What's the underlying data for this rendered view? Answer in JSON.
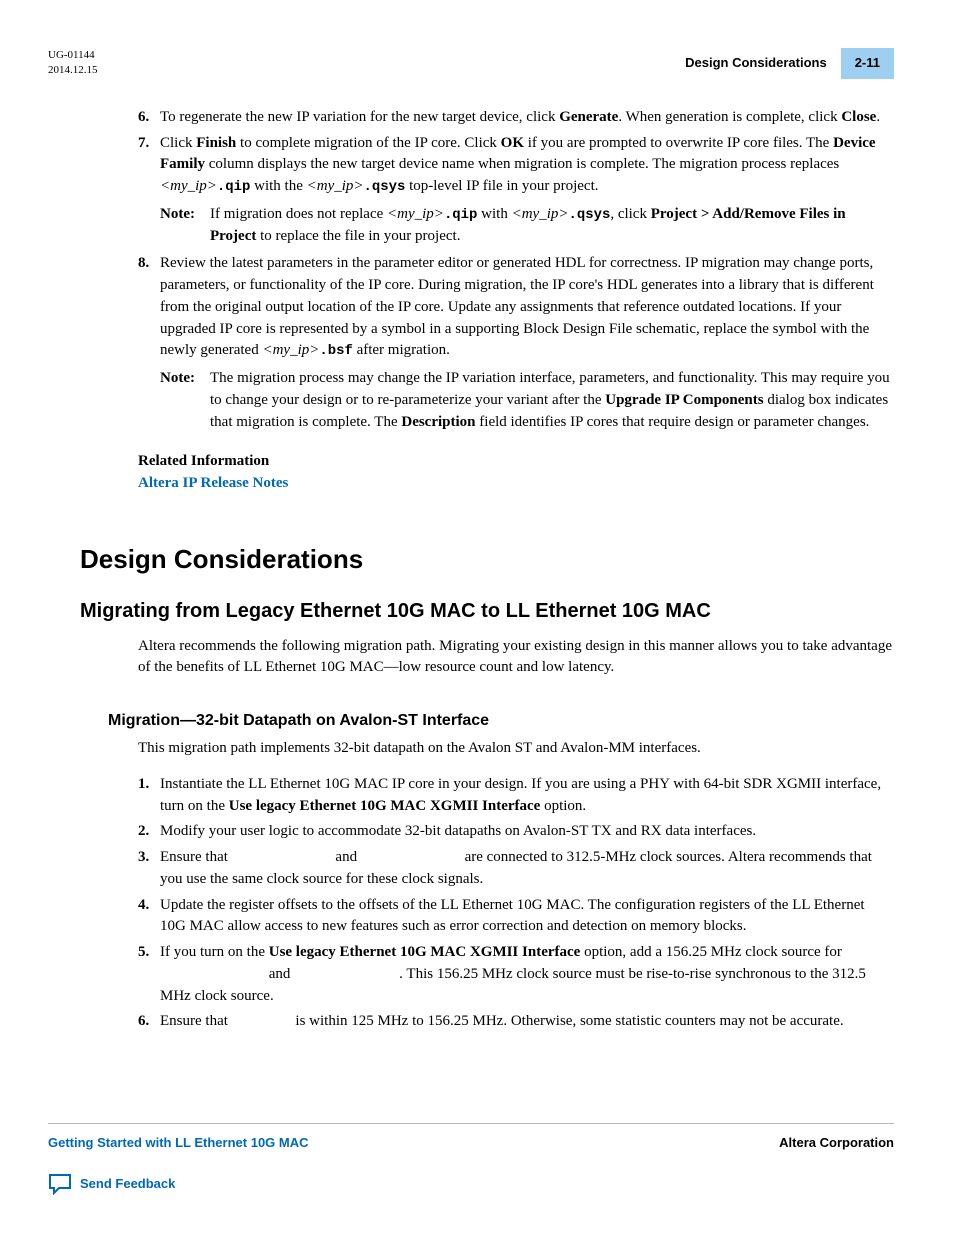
{
  "header": {
    "doc_id": "UG-01144",
    "date": "2014.12.15",
    "section_title": "Design Considerations",
    "page_num": "2-11"
  },
  "steps_top": {
    "s6_num": "6.",
    "s6_a": "To regenerate the new IP variation for the new target device, click ",
    "s6_generate": "Generate",
    "s6_b": ". When generation is complete, click ",
    "s6_close": "Close",
    "s6_c": ".",
    "s7_num": "7.",
    "s7_a": "Click ",
    "s7_finish": "Finish",
    "s7_b": " to complete migration of the IP core. Click ",
    "s7_ok": "OK",
    "s7_c": " if you are prompted to overwrite IP core files. The ",
    "s7_devfam": "Device Family",
    "s7_d": " column displays the new target device name when migration is complete. The migration process replaces ",
    "s7_myip1": "<my_ip>",
    "s7_qip": ".qip",
    "s7_e": " with the ",
    "s7_myip2": "<my_ip>",
    "s7_qsys": ".qsys",
    "s7_f": " top-level IP file in your project.",
    "note7_label": "Note:",
    "note7_a": "If migration does not replace ",
    "note7_myip1": "<my_ip>",
    "note7_qip": ".qip",
    "note7_b": " with ",
    "note7_myip2": "<my_ip>",
    "note7_qsys": ".qsys",
    "note7_c": ", click ",
    "note7_proj": "Project > Add/Remove Files in Project",
    "note7_d": " to replace the file in your project.",
    "s8_num": "8.",
    "s8_a": "Review the latest parameters in the parameter editor or generated HDL for correctness. IP migration may change ports, parameters, or functionality of the IP core. During migration, the IP core's HDL generates into a library that is different from the original output location of the IP core. Update any assignments that reference outdated locations. If your upgraded IP core is represented by a symbol in a supporting Block Design File schematic, replace the symbol with the newly generated ",
    "s8_myip": "<my_ip>",
    "s8_bsf": ".bsf",
    "s8_b": " after migration.",
    "note8_label": "Note:",
    "note8_a": "The migration process may change the IP variation interface, parameters, and functionality. This may require you to change your design or to re-parameterize your variant after the ",
    "note8_upgrade": "Upgrade IP Components",
    "note8_b": " dialog box indicates that migration is complete. The ",
    "note8_desc": "Description",
    "note8_c": " field identifies IP cores that require design or parameter changes."
  },
  "related": {
    "heading": "Related Information",
    "link": "Altera IP Release Notes"
  },
  "h1": "Design Considerations",
  "h2": "Migrating from Legacy Ethernet 10G MAC to LL Ethernet 10G MAC",
  "para1": "Altera recommends the following migration path. Migrating your existing design in this manner allows you to take advantage of the benefits of LL Ethernet 10G MAC—low resource count and low latency.",
  "h3": "Migration—32-bit Datapath on Avalon-ST Interface",
  "para2": "This migration path implements 32-bit datapath on the Avalon ST and Avalon-MM interfaces.",
  "mig": {
    "m1_num": "1.",
    "m1_a": "Instantiate the LL Ethernet 10G MAC IP core in your design. If you are using a PHY with 64-bit SDR XGMII interface, turn on the ",
    "m1_opt": "Use legacy Ethernet 10G MAC XGMII Interface",
    "m1_b": " option.",
    "m2_num": "2.",
    "m2": "Modify your user logic to accommodate 32-bit datapaths on Avalon-ST TX and RX data interfaces.",
    "m3_num": "3.",
    "m3_a": "Ensure that ",
    "m3_b": " and ",
    "m3_c": " are connected to 312.5-MHz clock sources. Altera recommends that you use the same clock source for these clock signals.",
    "m4_num": "4.",
    "m4": "Update the register offsets to the offsets of the LL Ethernet 10G MAC. The configuration registers of the LL Ethernet 10G MAC allow access to new features such as error correction and detection on memory blocks.",
    "m5_num": "5.",
    "m5_a": "If you turn on the ",
    "m5_opt": "Use legacy Ethernet 10G MAC XGMII Interface",
    "m5_b": " option, add a 156.25 MHz clock source for ",
    "m5_c": " and ",
    "m5_d": ". This 156.25 MHz clock source must be rise-to-rise synchronous to the 312.5 MHz clock source.",
    "m6_num": "6.",
    "m6_a": "Ensure that ",
    "m6_b": " is within 125 MHz to 156.25 MHz. Otherwise, some statistic counters may not be accurate."
  },
  "footer": {
    "left": "Getting Started with LL Ethernet 10G MAC",
    "right": "Altera Corporation",
    "feedback": "Send Feedback"
  }
}
